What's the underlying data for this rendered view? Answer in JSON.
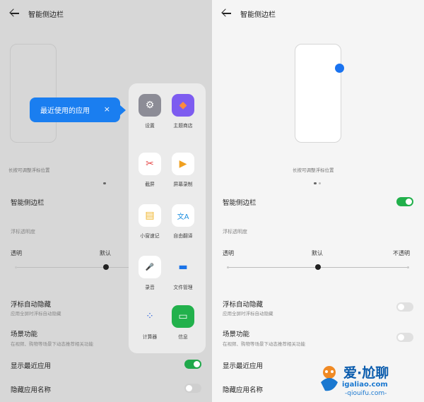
{
  "left": {
    "header": {
      "title": "智能侧边栏"
    },
    "hint": "长按可调整浮标位置",
    "settings": {
      "sidebar_label": "智能侧边栏",
      "opacity_label": "浮标透明度",
      "opacity_min": "透明",
      "opacity_default": "默认",
      "auto_hide_title": "浮标自动隐藏",
      "auto_hide_sub": "应用全屏时浮标自动隐藏",
      "scene_title": "场景功能",
      "scene_sub": "在视频、购物等场景下动态推荐相关功能",
      "recent_title": "显示最近应用",
      "hide_name_title": "隐藏应用名称"
    },
    "tooltip": {
      "text": "最近使用的应用",
      "close": "×"
    },
    "apps": [
      {
        "label": "设置",
        "icon": "gear-icon",
        "glyph": "⚙",
        "bg": "#8c8c96",
        "fg": "#ffffff"
      },
      {
        "label": "主题商店",
        "icon": "theme-brush-icon",
        "glyph": "◆",
        "bg": "#7d5cf0",
        "fg": "#ff8a3d"
      },
      {
        "label": "截屏",
        "icon": "scissors-icon",
        "glyph": "✂",
        "bg": "#ffffff",
        "fg": "#e64545"
      },
      {
        "label": "屏幕录制",
        "icon": "video-record-icon",
        "glyph": "▶",
        "bg": "#ffffff",
        "fg": "#f0a020"
      },
      {
        "label": "小窗速记",
        "icon": "note-icon",
        "glyph": "▤",
        "bg": "#ffffff",
        "fg": "#f0b429"
      },
      {
        "label": "自由翻译",
        "icon": "translate-icon",
        "glyph": "文A",
        "bg": "#ffffff",
        "fg": "#1e8fe0"
      },
      {
        "label": "录音",
        "icon": "microphone-icon",
        "glyph": "🎤",
        "bg": "#ffffff",
        "fg": "#e64545"
      },
      {
        "label": "文件管理",
        "icon": "folder-icon",
        "glyph": "▬",
        "bg": "#ebebeb",
        "fg": "#1a73e8"
      },
      {
        "label": "计算器",
        "icon": "calculator-icon",
        "glyph": "⁘",
        "bg": "#ebebeb",
        "fg": "#3b6ee0"
      },
      {
        "label": "信息",
        "icon": "message-icon",
        "glyph": "▭",
        "bg": "#22b14c",
        "fg": "#ffffff"
      }
    ]
  },
  "right": {
    "header": {
      "title": "智能侧边栏"
    },
    "hint": "长按可调整浮标位置",
    "settings": {
      "sidebar_label": "智能侧边栏",
      "opacity_label": "浮标透明度",
      "opacity_min": "透明",
      "opacity_default": "默认",
      "opacity_max": "不透明",
      "auto_hide_title": "浮标自动隐藏",
      "auto_hide_sub": "应用全屏时浮标自动隐藏",
      "scene_title": "场景功能",
      "scene_sub": "在视频、购物等场景下动态推荐相关功能",
      "recent_title": "显示最近应用",
      "hide_name_title": "隐藏应用名称"
    }
  },
  "toggles": {
    "sidebar_enabled": true,
    "auto_hide": false,
    "scene": false,
    "show_recent": true,
    "hide_name": false
  },
  "colors": {
    "accent_blue": "#1a7ef0",
    "toggle_on": "#21b04b"
  },
  "watermark": {
    "brand": "爱·尬聊",
    "url": "igaliao.com",
    "sub": "-qiouifu.com-"
  }
}
